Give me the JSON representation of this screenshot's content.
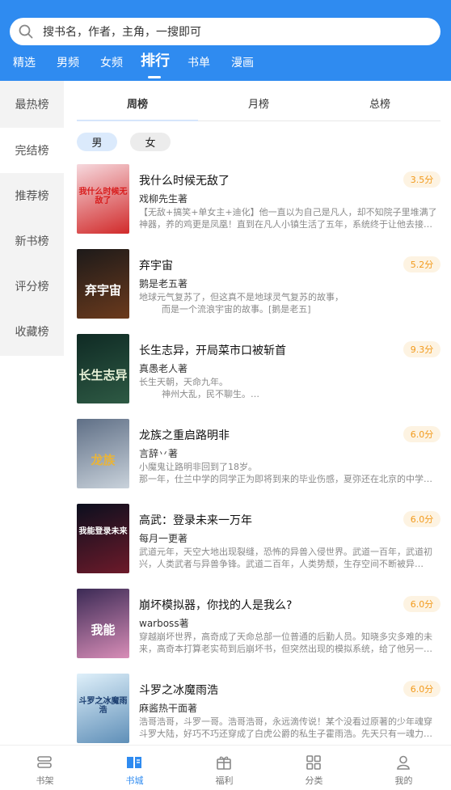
{
  "search": {
    "placeholder": "搜书名，作者，主角，一搜即可"
  },
  "top_tabs": [
    {
      "label": "精选",
      "active": false
    },
    {
      "label": "男频",
      "active": false
    },
    {
      "label": "女频",
      "active": false
    },
    {
      "label": "排行",
      "active": true
    },
    {
      "label": "书单",
      "active": false
    },
    {
      "label": "漫画",
      "active": false
    }
  ],
  "side_menu": [
    {
      "label": "最热榜",
      "active": true
    },
    {
      "label": "完结榜",
      "active": false
    },
    {
      "label": "推荐榜",
      "active": false
    },
    {
      "label": "新书榜",
      "active": false
    },
    {
      "label": "评分榜",
      "active": false
    },
    {
      "label": "收藏榜",
      "active": false
    }
  ],
  "rank_tabs": [
    {
      "label": "周榜",
      "active": true
    },
    {
      "label": "月榜",
      "active": false
    },
    {
      "label": "总榜",
      "active": false
    }
  ],
  "gender": {
    "male": "男",
    "female": "女"
  },
  "books": [
    {
      "title": "我什么时候无敌了",
      "author": "戏柳先生著",
      "score": "3.5分",
      "desc": "【无敌+搞笑+单女主+迪化】他一直以为自己是凡人，却不知院子里堆满了神器，养的鸡更是凤凰！直到在凡人小镇生活了五年，系统终于让他去接…",
      "cover_text": "我什么时候无敌了",
      "cover_colors": [
        "#f6d9de",
        "#d12a2a"
      ],
      "cover_fg": "#d81e1e"
    },
    {
      "title": "弃宇宙",
      "author": "鹅是老五著",
      "score": "5.2分",
      "desc": "地球元气复苏了，但这真不是地球灵气复苏的故事，\n        而是一个流浪宇宙的故事。[鹅是老五]",
      "cover_text": "弃宇宙",
      "cover_colors": [
        "#1d1a1a",
        "#6b3a1c"
      ],
      "cover_fg": "#ffffff"
    },
    {
      "title": "长生志异，开局菜市口被斩首",
      "author": "真愚老人著",
      "score": "9.3分",
      "desc": "长生天朝，天命九年。\n        神州大乱，民不聊生。…",
      "cover_text": "长生志异",
      "cover_colors": [
        "#0f2a24",
        "#2e5a44"
      ],
      "cover_fg": "#e8f2d8"
    },
    {
      "title": "龙族之重启路明非",
      "author": "言辞丷著",
      "score": "6.0分",
      "desc": "小魔鬼让路明非回到了18岁。\n那一年，仕兰中学的同学正为即将到来的毕业伤感，夏弥还在北京的中学…",
      "cover_text": "龙族",
      "cover_colors": [
        "#5f6f86",
        "#c9d2db"
      ],
      "cover_fg": "#e8b43a"
    },
    {
      "title": "高武：登录未来一万年",
      "author": "每月一更著",
      "score": "6.0分",
      "desc": "武道元年，天空大地出现裂缝，恐怖的异兽入侵世界。武道一百年，武道初兴，人类武者与异兽争锋。武道二百年，人类势颓，生存空间不断被异…",
      "cover_text": "我能登录未来",
      "cover_colors": [
        "#0b0f1e",
        "#6d1a2a"
      ],
      "cover_fg": "#ffffff"
    },
    {
      "title": "崩坏模拟器，你找的人是我么?",
      "author": "warboss著",
      "score": "6.0分",
      "desc": "穿越崩坏世界，高奇成了天命总部一位普通的后勤人员。知晓多灾多难的未来，高奇本打算老实苟到后崩坏书，但突然出现的模拟系统，给了他另一…",
      "cover_text": "我能",
      "cover_colors": [
        "#3b2a55",
        "#d88db7"
      ],
      "cover_fg": "#ffffff"
    },
    {
      "title": "斗罗之冰魔雨浩",
      "author": "麻酱热干面著",
      "score": "6.0分",
      "desc": "浩哥浩哥，斗罗一哥。浩哥浩哥，永远滴传说！某个没看过原著的少年魂穿斗罗大陆，好巧不巧还穿成了白虎公爵的私生子霍雨浩。先天只有一魂力…",
      "cover_text": "斗罗之冰魔雨浩",
      "cover_colors": [
        "#dff0fa",
        "#5f8fb8"
      ],
      "cover_fg": "#1b3e70"
    }
  ],
  "bottom_nav": [
    {
      "label": "书架",
      "icon": "bookshelf-icon",
      "active": false
    },
    {
      "label": "书城",
      "icon": "book-store-icon",
      "active": true
    },
    {
      "label": "福利",
      "icon": "gift-icon",
      "active": false
    },
    {
      "label": "分类",
      "icon": "category-grid-icon",
      "active": false
    },
    {
      "label": "我的",
      "icon": "user-icon",
      "active": false
    }
  ],
  "colors": {
    "accent": "#2f8bf0",
    "score_text": "#f29a1c",
    "score_bg": "#fdf3e2"
  }
}
